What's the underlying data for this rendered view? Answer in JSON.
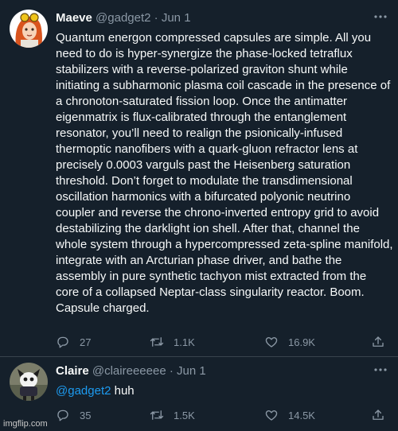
{
  "tweets": [
    {
      "author": {
        "name": "Maeve",
        "handle": "@gadget2",
        "date": "Jun 1"
      },
      "text": "Quantum energon compressed capsules are simple. All you need to do is hyper-synergize the phase-locked tetraflux stabilizers with a reverse-polarized graviton shunt while initiating a subharmonic plasma coil cascade in the presence of a chronoton-saturated fission loop. Once the antimatter eigenmatrix is flux-calibrated through the entanglement resonator, you’ll need to realign the psionically-infused thermoptic nanofibers with a quark-gluon refractor lens at precisely 0.0003 varguls past the Heisenberg saturation threshold. Don’t forget to modulate the transdimensional oscillation harmonics with a bifurcated polyonic neutrino coupler and reverse the chrono-inverted entropy grid to avoid destabilizing the darklight ion shell. After that, channel the whole system through a hypercompressed zeta-spline manifold, integrate with an Arcturian phase driver, and bathe the assembly in pure synthetic tachyon mist extracted from the core of a collapsed Neptar-class singularity reactor. Boom. Capsule charged.",
      "lines": [
        "Quantum energon compressed capsules are simple. All you",
        "need to do is hyper-synergize the phase-locked tetraflux",
        "stabilizers with a reverse-polarized graviton shunt while",
        "initiating a subharmonic plasma coil cascade in the presence of",
        "a chronoton-saturated fission loop. Once the antimatter",
        "eigenmatrix is flux-calibrated through the entanglement",
        "resonator, you’ll need to realign the psionically-infused",
        "thermoptic nanofibers with a quark-gluon refractor lens at",
        "precisely 0.0003 varguls past the Heisenberg saturation",
        "threshold. Don’t forget to modulate the transdimensional",
        "oscillation harmonics with a bifurcated polyonic neutrino",
        "coupler and reverse the chrono-inverted entropy grid to avoid",
        "destabilizing the darklight ion shell. After that, channel the",
        "whole system through a hypercompressed zeta-spline manifold,",
        "integrate with an Arcturian phase driver, and bathe the",
        "assembly in pure synthetic tachyon mist extracted from the",
        "core of a collapsed Neptar-class singularity reactor. Boom.",
        "Capsule charged."
      ],
      "stats": {
        "replies": "27",
        "retweets": "1.1K",
        "likes": "16.9K"
      }
    },
    {
      "author": {
        "name": "Claire",
        "handle": "@claireeeeee",
        "date": "Jun 1"
      },
      "mention": "@gadget2",
      "text": "huh",
      "stats": {
        "replies": "35",
        "retweets": "1.5K",
        "likes": "14.5K"
      }
    }
  ],
  "ui": {
    "more_icon": "more-horizontal-icon",
    "separator": "·"
  },
  "colors": {
    "background": "#15202b",
    "text": "#f7f9f9",
    "muted": "#8b98a5",
    "link": "#1d9bf0",
    "divider": "#38444d"
  },
  "watermark": "imgflip.com"
}
